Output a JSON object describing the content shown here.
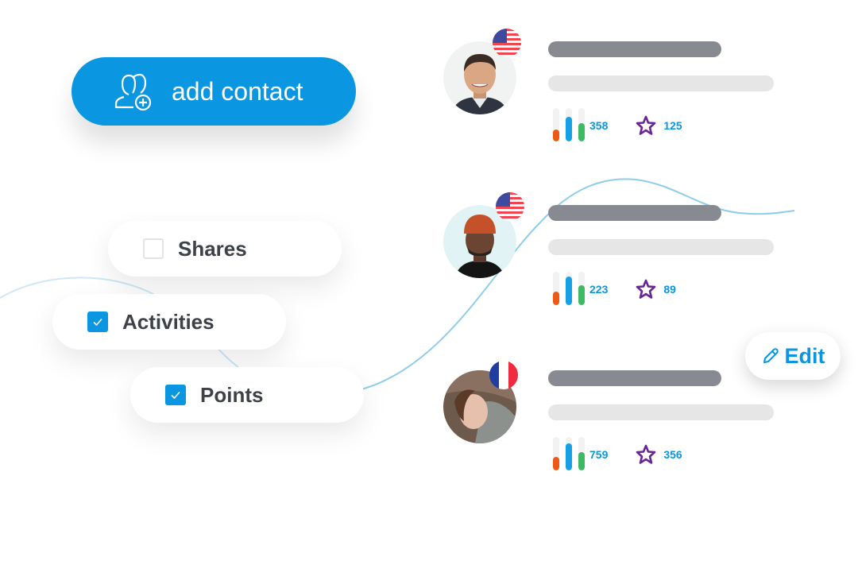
{
  "add_contact": {
    "label": "add contact",
    "icon": "add-user-icon"
  },
  "filters": [
    {
      "label": "Shares",
      "checked": false
    },
    {
      "label": "Activities",
      "checked": true
    },
    {
      "label": "Points",
      "checked": true
    }
  ],
  "contacts": [
    {
      "country": "US",
      "flag_icon": "us-flag-icon",
      "activity_count": "358",
      "points": "125",
      "activity_bars": [
        0.35,
        0.75,
        0.55
      ]
    },
    {
      "country": "US",
      "flag_icon": "us-flag-icon",
      "activity_count": "223",
      "points": "89",
      "activity_bars": [
        0.4,
        0.85,
        0.6
      ]
    },
    {
      "country": "FR",
      "flag_icon": "fr-flag-icon",
      "activity_count": "759",
      "points": "356",
      "activity_bars": [
        0.4,
        0.8,
        0.55
      ]
    }
  ],
  "edit": {
    "label": "Edit",
    "icon": "pencil-icon"
  },
  "colors": {
    "primary": "#0a96e0",
    "bar_orange": "#ee5a16",
    "bar_blue": "#16a0e6",
    "bar_green": "#3dba63",
    "star_purple": "#6b2496",
    "name_placeholder": "#878a91",
    "subtitle_placeholder": "#e6e6e6"
  }
}
